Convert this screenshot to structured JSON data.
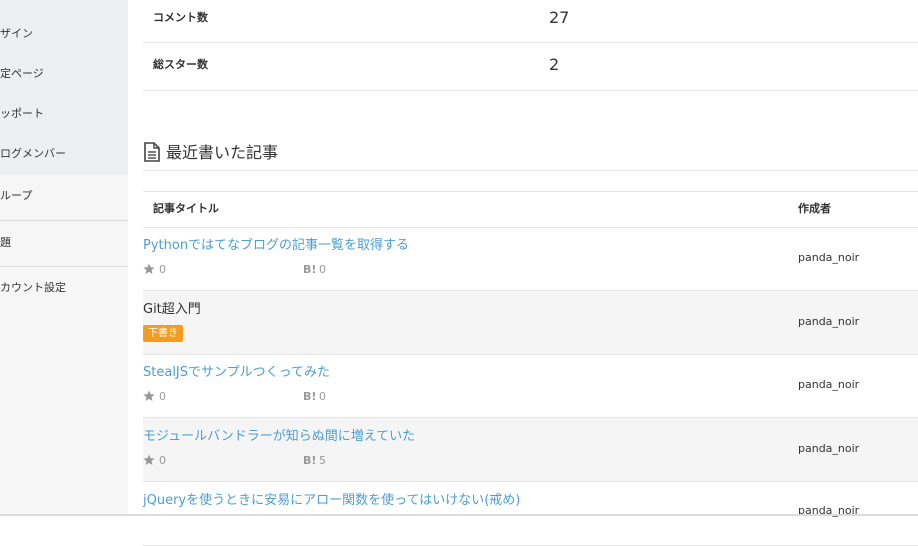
{
  "sidebar": {
    "items": [
      {
        "label": "ザイン"
      },
      {
        "label": "定ページ"
      },
      {
        "label": "ッポート"
      },
      {
        "label": "ログメンバー"
      },
      {
        "label": "ループ"
      },
      {
        "label": "題"
      },
      {
        "label": "カウント設定"
      }
    ]
  },
  "stats": {
    "comments_label": "コメント数",
    "comments_value": "27",
    "stars_label": "総スター数",
    "stars_value": "2"
  },
  "recent": {
    "title": "最近書いた記事",
    "col_title": "記事タイトル",
    "col_author": "作成者",
    "hatebu_mark": "B!",
    "draft_label": "下書き",
    "rows": [
      {
        "title": "Pythonではてなブログの記事一覧を取得する",
        "stars": "0",
        "bookmarks": "0",
        "author": "panda_noir"
      },
      {
        "title": "Git超入門",
        "author": "panda_noir"
      },
      {
        "title": "StealJSでサンプルつくってみた",
        "stars": "0",
        "bookmarks": "0",
        "author": "panda_noir"
      },
      {
        "title": "モジュールバンドラーが知らぬ間に増えていた",
        "stars": "0",
        "bookmarks": "5",
        "author": "panda_noir"
      },
      {
        "title": "jQueryを使うときに安易にアロー関数を使ってはいけない(戒め)",
        "author": "panda_noir"
      }
    ]
  },
  "colors": {
    "link": "#4d9ed0",
    "draft_badge": "#f39c1f",
    "sidebar_bg": "#f6f6f6"
  }
}
